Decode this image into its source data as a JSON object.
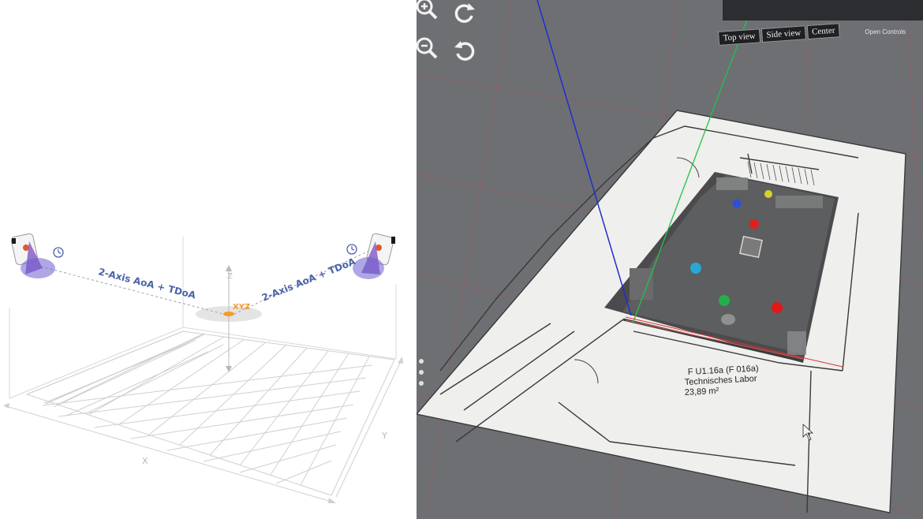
{
  "diagram": {
    "left_link_label": "2-Axis AoA + TDoA",
    "right_link_label": "2-Axis AoA + TDoA",
    "target_label": "XYZ",
    "axis_z": "Z",
    "axis_x": "X",
    "axis_y": "Y"
  },
  "viewer": {
    "open_controls": "Open Controls",
    "view_buttons": [
      "Top view",
      "Side view",
      "Center"
    ],
    "room_label": {
      "line1": "F U1.16a (F 016a)",
      "line2": "Technisches Labor",
      "line3": "23,89 m²"
    },
    "markers": [
      {
        "color": "#2f4fd6"
      },
      {
        "color": "#d7d22a"
      },
      {
        "color": "#e02020"
      },
      {
        "color": "#2aa7d6"
      },
      {
        "color": "#22b04a"
      },
      {
        "color": "#e01818"
      }
    ],
    "icons": [
      "zoom-in-icon",
      "rotate-cw-icon",
      "zoom-out-icon",
      "rotate-ccw-icon"
    ]
  }
}
